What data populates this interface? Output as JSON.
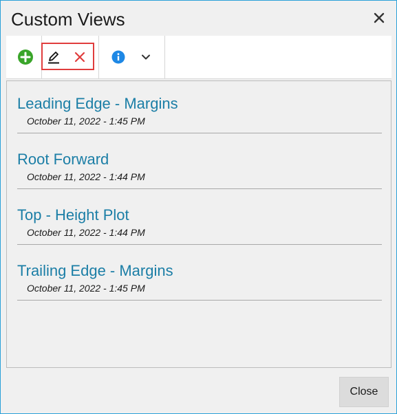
{
  "dialog": {
    "title": "Custom Views",
    "close_icon": "close-icon"
  },
  "toolbar": {
    "add_icon": "plus-circle-icon",
    "edit_icon": "pencil-icon",
    "delete_icon": "delete-x-icon",
    "info_icon": "info-icon",
    "more_icon": "chevron-down-icon",
    "colors": {
      "add": "#3aa52a",
      "delete": "#e03c3c",
      "info": "#1e88e5",
      "highlight": "#e03c3c"
    }
  },
  "views": [
    {
      "name": "Leading Edge - Margins",
      "date": "October 11, 2022 - 1:45 PM"
    },
    {
      "name": "Root Forward",
      "date": "October 11, 2022 - 1:44 PM"
    },
    {
      "name": "Top - Height Plot",
      "date": "October 11, 2022 - 1:44 PM"
    },
    {
      "name": "Trailing Edge - Margins",
      "date": "October 11, 2022 - 1:45 PM"
    }
  ],
  "footer": {
    "close_label": "Close"
  },
  "colors": {
    "accent_text": "#1b7ea6",
    "window_border": "#29a0d8"
  }
}
